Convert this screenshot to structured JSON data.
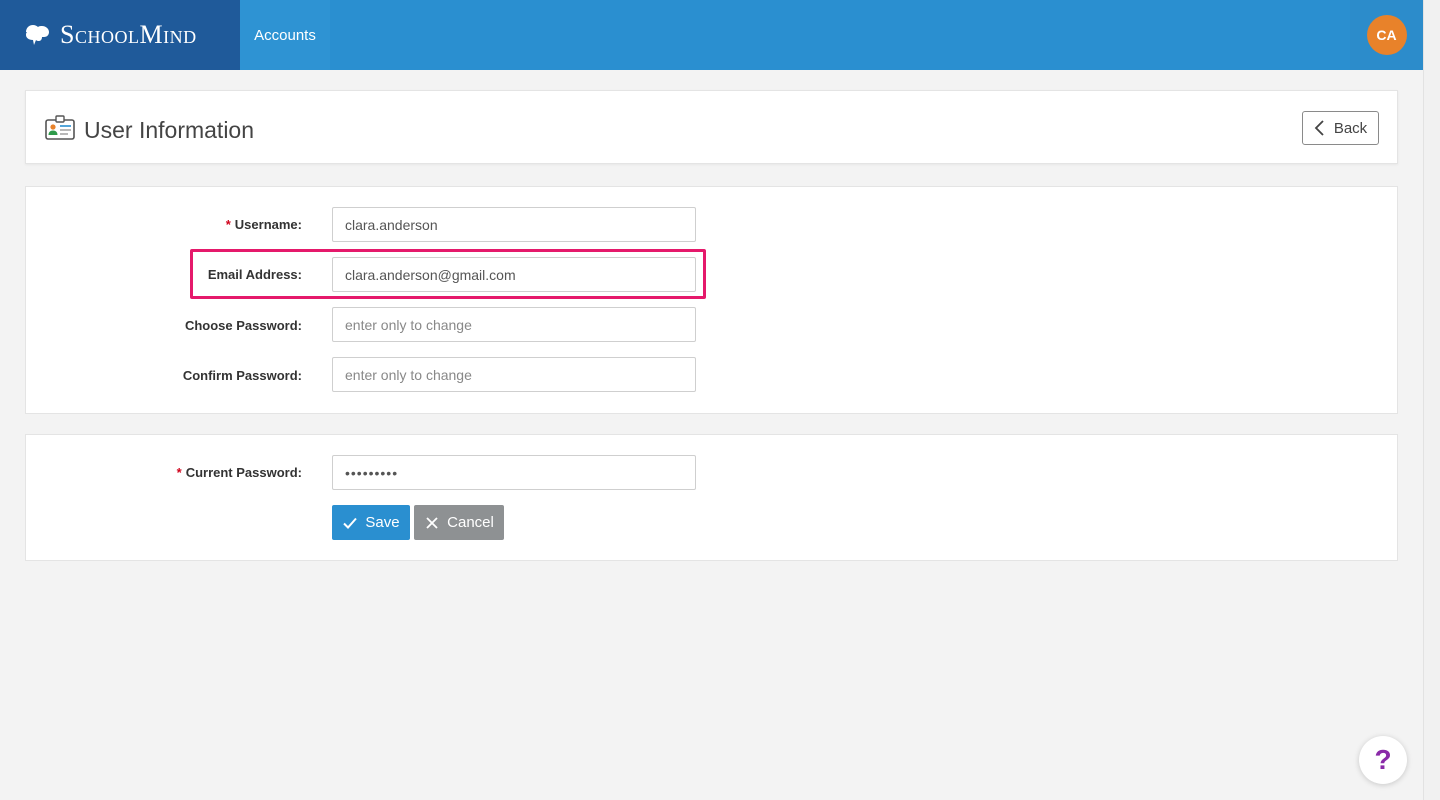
{
  "app": {
    "brand_name": "SchoolMind",
    "nav_accounts": "Accounts",
    "user_initials": "CA"
  },
  "header": {
    "title": "User Information",
    "back_label": "Back"
  },
  "form": {
    "username": {
      "label": "Username:",
      "required_mark": "*",
      "value": "clara.anderson"
    },
    "email": {
      "label": "Email Address:",
      "value": "clara.anderson@gmail.com"
    },
    "choose_password": {
      "label": "Choose Password:",
      "placeholder": "enter only to change"
    },
    "confirm_password": {
      "label": "Confirm Password:",
      "placeholder": "enter only to change"
    }
  },
  "security": {
    "current_password": {
      "label": "Current Password:",
      "required_mark": "*",
      "value": "•••••••••"
    },
    "save_label": "Save",
    "cancel_label": "Cancel"
  },
  "help": {
    "label": "?"
  },
  "colors": {
    "topbar": "#2a8fd0",
    "brand_bg": "#1f5a9a",
    "avatar": "#e8822a",
    "highlight": "#e5196b",
    "save": "#2a8fd0",
    "cancel": "#8e9193",
    "help_glyph": "#8a2aa8"
  }
}
